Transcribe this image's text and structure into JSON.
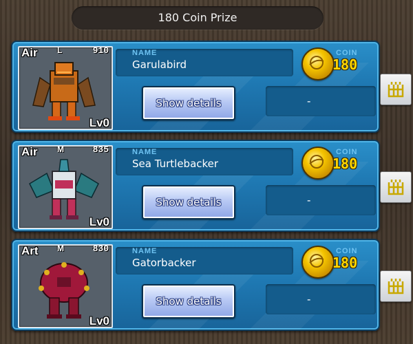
{
  "header": {
    "title": "180 Coin Prize"
  },
  "colors": {
    "card_blue": "#1f79b3",
    "coin_gold": "#f5c400",
    "coin_text": "#ffd800"
  },
  "cards": [
    {
      "type": "Air",
      "size": "L",
      "power": "910",
      "level": "Lv0",
      "name_caption": "NAME",
      "name": "Garulabird",
      "coin_caption": "COIN",
      "coin": "180",
      "button_label": "Show details",
      "value": "-",
      "portrait_icon": "orange-bird-mech-portrait"
    },
    {
      "type": "Air",
      "size": "M",
      "power": "835",
      "level": "Lv0",
      "name_caption": "NAME",
      "name": "Sea Turtlebacker",
      "coin_caption": "COIN",
      "coin": "180",
      "button_label": "Show details",
      "value": "-",
      "portrait_icon": "teal-winged-mech-portrait"
    },
    {
      "type": "Art",
      "size": "M",
      "power": "830",
      "level": "Lv0",
      "name_caption": "NAME",
      "name": "Gatorbacker",
      "coin_caption": "COIN",
      "coin": "180",
      "button_label": "Show details",
      "value": "-",
      "portrait_icon": "crimson-mech-portrait"
    }
  ],
  "side_buttons": [
    {
      "icon": "grid-building-icon"
    },
    {
      "icon": "grid-building-icon"
    },
    {
      "icon": "grid-building-icon"
    }
  ]
}
